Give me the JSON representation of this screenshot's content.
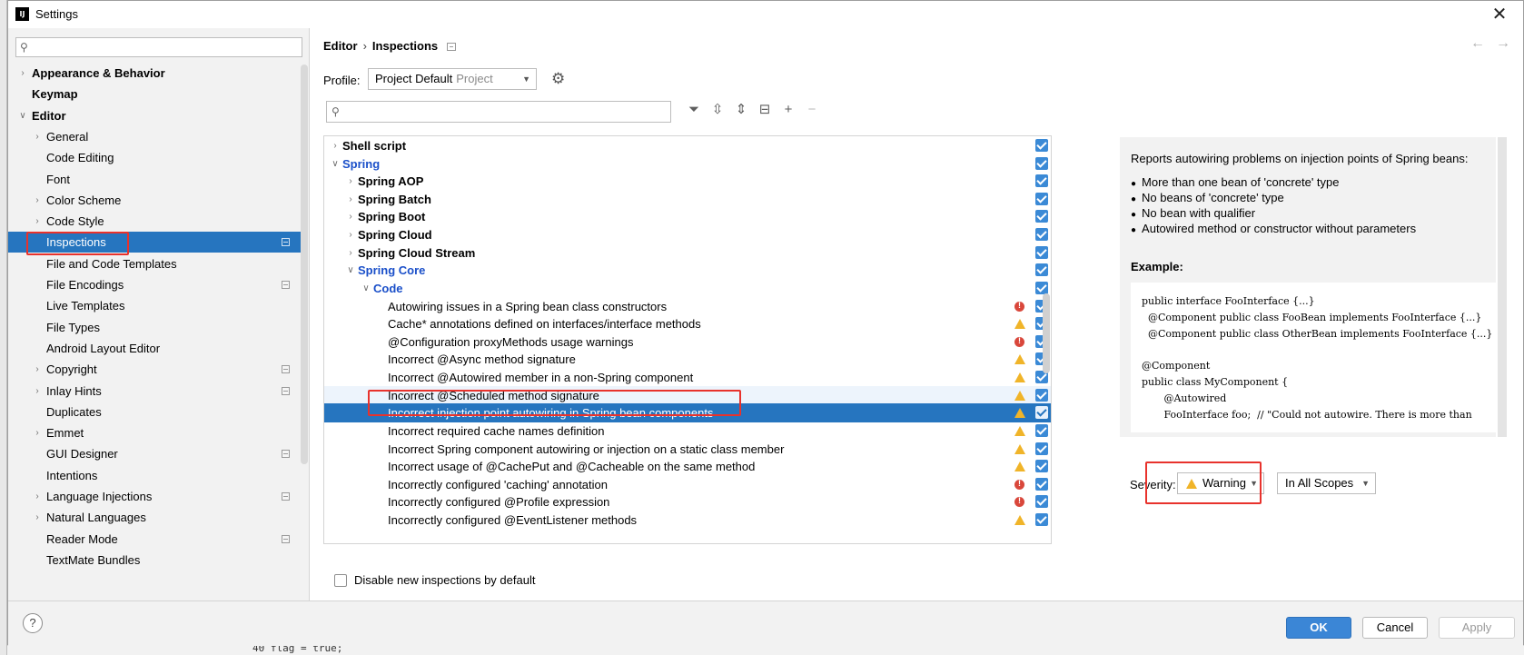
{
  "window": {
    "title": "Settings",
    "app_icon": "IJ"
  },
  "sidebar": {
    "search_placeholder": "",
    "items": [
      {
        "label": "Appearance & Behavior",
        "bold": true,
        "chevron": "right",
        "level": 0
      },
      {
        "label": "Keymap",
        "bold": true,
        "chevron": "none",
        "level": 0
      },
      {
        "label": "Editor",
        "bold": true,
        "chevron": "down",
        "level": 0
      },
      {
        "label": "General",
        "chevron": "right",
        "level": 1
      },
      {
        "label": "Code Editing",
        "chevron": "none",
        "level": 1
      },
      {
        "label": "Font",
        "chevron": "none",
        "level": 1
      },
      {
        "label": "Color Scheme",
        "chevron": "right",
        "level": 1
      },
      {
        "label": "Code Style",
        "chevron": "right",
        "level": 1
      },
      {
        "label": "Inspections",
        "chevron": "none",
        "level": 1,
        "selected": true,
        "project_icon": true
      },
      {
        "label": "File and Code Templates",
        "chevron": "none",
        "level": 1
      },
      {
        "label": "File Encodings",
        "chevron": "none",
        "level": 1,
        "project_icon": true
      },
      {
        "label": "Live Templates",
        "chevron": "none",
        "level": 1
      },
      {
        "label": "File Types",
        "chevron": "none",
        "level": 1
      },
      {
        "label": "Android Layout Editor",
        "chevron": "none",
        "level": 1
      },
      {
        "label": "Copyright",
        "chevron": "right",
        "level": 1,
        "project_icon": true
      },
      {
        "label": "Inlay Hints",
        "chevron": "right",
        "level": 1,
        "project_icon": true
      },
      {
        "label": "Duplicates",
        "chevron": "none",
        "level": 1
      },
      {
        "label": "Emmet",
        "chevron": "right",
        "level": 1
      },
      {
        "label": "GUI Designer",
        "chevron": "none",
        "level": 1,
        "project_icon": true
      },
      {
        "label": "Intentions",
        "chevron": "none",
        "level": 1
      },
      {
        "label": "Language Injections",
        "chevron": "right",
        "level": 1,
        "project_icon": true
      },
      {
        "label": "Natural Languages",
        "chevron": "right",
        "level": 1
      },
      {
        "label": "Reader Mode",
        "chevron": "none",
        "level": 1,
        "project_icon": true
      },
      {
        "label": "TextMate Bundles",
        "chevron": "none",
        "level": 1
      }
    ]
  },
  "breadcrumb": {
    "parent": "Editor",
    "separator": "›",
    "current": "Inspections"
  },
  "nav": {
    "back": "←",
    "forward": "→"
  },
  "profile": {
    "label": "Profile:",
    "value": "Project Default",
    "scope": "Project"
  },
  "inspection_search": {
    "placeholder": ""
  },
  "toolbar": {
    "filter": "⏷",
    "expand": "⇳",
    "collapse": "⇕",
    "reset": "⊟",
    "add": "+",
    "remove": "−"
  },
  "inspections": [
    {
      "label": "Shell script",
      "level": 0,
      "chevron": "right",
      "bold": true,
      "checked": true
    },
    {
      "label": "Spring",
      "level": 0,
      "chevron": "down",
      "bold": true,
      "blue": true,
      "checked": true
    },
    {
      "label": "Spring AOP",
      "level": 1,
      "chevron": "right",
      "bold": true,
      "checked": true
    },
    {
      "label": "Spring Batch",
      "level": 1,
      "chevron": "right",
      "bold": true,
      "checked": true
    },
    {
      "label": "Spring Boot",
      "level": 1,
      "chevron": "right",
      "bold": true,
      "checked": true
    },
    {
      "label": "Spring Cloud",
      "level": 1,
      "chevron": "right",
      "bold": true,
      "checked": true
    },
    {
      "label": "Spring Cloud Stream",
      "level": 1,
      "chevron": "right",
      "bold": true,
      "checked": true
    },
    {
      "label": "Spring Core",
      "level": 1,
      "chevron": "down",
      "bold": true,
      "blue": true,
      "checked": true
    },
    {
      "label": "Code",
      "level": 2,
      "chevron": "down",
      "bold": true,
      "blue": true,
      "checked": true
    },
    {
      "label": "Autowiring issues in a Spring bean class constructors",
      "level": 3,
      "severity": "error",
      "checked": true
    },
    {
      "label": "Cache* annotations defined on interfaces/interface methods",
      "level": 3,
      "severity": "warning",
      "checked": true
    },
    {
      "label": "@Configuration proxyMethods usage warnings",
      "level": 3,
      "severity": "error",
      "checked": true
    },
    {
      "label": "Incorrect @Async method signature",
      "level": 3,
      "severity": "warning",
      "checked": true
    },
    {
      "label": "Incorrect @Autowired member in a non-Spring component",
      "level": 3,
      "severity": "warning",
      "checked": true
    },
    {
      "label": "Incorrect @Scheduled method signature",
      "level": 3,
      "severity": "warning",
      "checked": true,
      "hover": true
    },
    {
      "label": "Incorrect injection point autowiring in Spring bean components",
      "level": 3,
      "severity": "warning",
      "checked": true,
      "selected": true
    },
    {
      "label": "Incorrect required cache names definition",
      "level": 3,
      "severity": "warning",
      "checked": true
    },
    {
      "label": "Incorrect Spring component autowiring or injection on a static class member",
      "level": 3,
      "severity": "warning",
      "checked": true
    },
    {
      "label": "Incorrect usage of @CachePut and @Cacheable on the same method",
      "level": 3,
      "severity": "warning",
      "checked": true
    },
    {
      "label": "Incorrectly configured 'caching' annotation",
      "level": 3,
      "severity": "error",
      "checked": true
    },
    {
      "label": "Incorrectly configured @Profile expression",
      "level": 3,
      "severity": "error",
      "checked": true
    },
    {
      "label": "Incorrectly configured  @EventListener methods",
      "level": 3,
      "severity": "warning",
      "checked": true
    }
  ],
  "disable_new": {
    "label": "Disable new inspections by default",
    "checked": false
  },
  "description": {
    "intro": "Reports autowiring problems on injection points of Spring beans:",
    "bullets": [
      "More than one bean of 'concrete' type",
      "No beans of 'concrete' type",
      "No bean with qualifier",
      "Autowired method or constructor without parameters"
    ],
    "example_label": "Example:",
    "code_lines": [
      "public interface FooInterface {...}",
      "  @Component public class FooBean implements FooInterface {...}",
      "  @Component public class OtherBean implements FooInterface {...}",
      "",
      "@Component",
      "public class MyComponent {",
      "       @Autowired",
      "       FooInterface foo;  // \"Could not autowire. There is more than"
    ]
  },
  "severity": {
    "label": "Severity:",
    "value": "Warning",
    "scope": "In All Scopes"
  },
  "footer": {
    "help": "?",
    "ok": "OK",
    "cancel": "Cancel",
    "apply": "Apply"
  },
  "background_editor": {
    "gutter": "40",
    "code": "flag = true;"
  },
  "colors": {
    "selection": "#2675bf",
    "accent_button": "#3b86d6",
    "warning": "#f0b429",
    "error": "#d9473b",
    "annotation_box": "#e8322c"
  }
}
